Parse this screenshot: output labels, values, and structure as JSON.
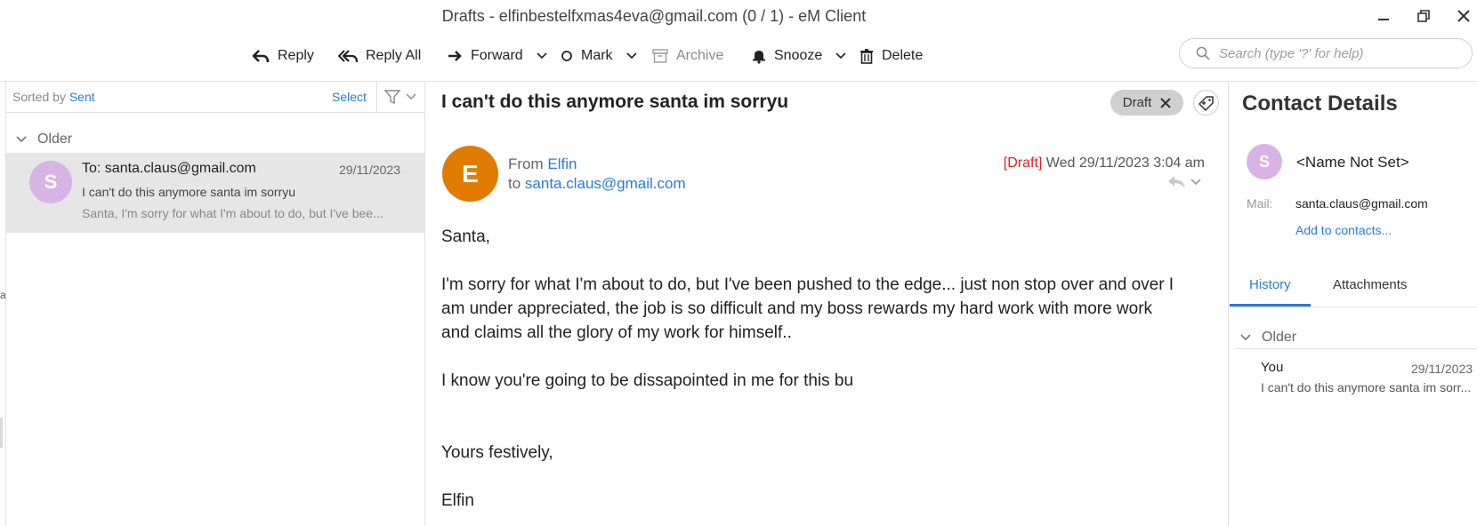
{
  "window": {
    "title": "Drafts - elfinbestelfxmas4eva@gmail.com (0 / 1) - eM Client"
  },
  "toolbar": {
    "reply": "Reply",
    "reply_all": "Reply All",
    "forward": "Forward",
    "mark": "Mark",
    "archive": "Archive",
    "snooze": "Snooze",
    "delete": "Delete"
  },
  "search": {
    "placeholder": "Search (type '?' for help)"
  },
  "message_list": {
    "sorted_by_label": "Sorted by",
    "sorted_by_value": "Sent",
    "select_label": "Select",
    "group": "Older",
    "items": [
      {
        "avatar_letter": "S",
        "avatar_color": "#d8b4e6",
        "to": "To: santa.claus@gmail.com",
        "date": "29/11/2023",
        "subject": "I can't do this anymore santa im sorryu",
        "preview": "Santa, I'm sorry for what I'm about to do, but I've bee..."
      }
    ]
  },
  "message": {
    "subject": "I can't do this anymore santa im sorryu",
    "draft_badge": "Draft",
    "avatar_letter": "E",
    "avatar_color": "#e07b00",
    "from_label": "From",
    "from_name": "Elfin",
    "to_label": "to",
    "to_address": "santa.claus@gmail.com",
    "draft_tag": "[Draft]",
    "datetime": "Wed 29/11/2023 3:04 am",
    "body": {
      "greeting": "Santa,",
      "para1_line1": "I'm sorry for what I'm about to do, but I've been pushed to the edge... just non stop over and over I",
      "para1_line2": "am under appreciated, the job is so difficult and my boss rewards my hard work with more work",
      "para1_line3": "and claims all the glory of my work for himself..",
      "para2": "I know you're going to be dissapointed in me for this bu",
      "signoff": "Yours festively,",
      "signature": "Elfin"
    }
  },
  "contact_details": {
    "title": "Contact Details",
    "avatar_letter": "S",
    "avatar_color": "#d8b4e6",
    "name": "<Name Not Set>",
    "mail_label": "Mail:",
    "mail_value": "santa.claus@gmail.com",
    "add_link": "Add to contacts...",
    "tabs": [
      "History",
      "Attachments"
    ],
    "history_group": "Older",
    "history_items": [
      {
        "who": "You",
        "date": "29/11/2023",
        "subject": "I can't do this anymore santa im sorr..."
      }
    ]
  },
  "colors": {
    "accent": "#2a7bd4",
    "draft_red": "#e02020"
  }
}
